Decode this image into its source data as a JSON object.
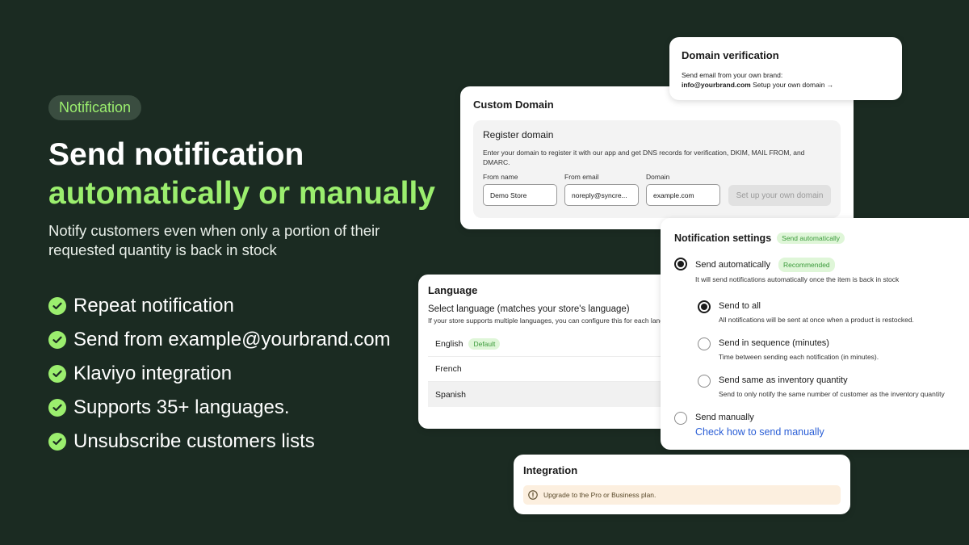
{
  "hero": {
    "pill": "Notification",
    "title_line1": "Send notification",
    "title_line2": "automatically or manually",
    "subtitle": "Notify customers even when only a portion of their requested quantity is back in stock",
    "features": [
      "Repeat notification",
      "Send from example@yourbrand.com",
      "Klaviyo integration",
      "Supports 35+ languages.",
      "Unsubscribe customers lists"
    ]
  },
  "domain_verification": {
    "title": "Domain verification",
    "line1": "Send email from your own brand:",
    "email": "info@yourbrand.com",
    "link": "Setup your own domain →"
  },
  "custom_domain": {
    "title": "Custom Domain",
    "register_title": "Register domain",
    "description": "Enter your domain to register it with our app and get DNS records for verification, DKIM, MAIL FROM, and DMARC.",
    "from_name_label": "From name",
    "from_name_value": "Demo Store",
    "from_email_label": "From email",
    "from_email_value": "noreply@syncre...",
    "domain_label": "Domain",
    "domain_value": "example.com",
    "button": "Set up your own domain"
  },
  "language": {
    "title": "Language",
    "select_label": "Select language (matches your store's language)",
    "hint": "If your store supports multiple languages, you can configure this for each language.",
    "languages": [
      {
        "name": "English",
        "badge": "Default"
      },
      {
        "name": "French"
      },
      {
        "name": "Spanish"
      }
    ]
  },
  "notification_settings": {
    "title": "Notification settings",
    "status_badge": "Send automatically",
    "auto_label": "Send automatically",
    "auto_badge": "Recommended",
    "auto_desc": "It will send notifications automatically once the item is back in stock",
    "all_label": "Send to all",
    "all_desc": "All notifications will be sent at once when a product is restocked.",
    "sequence_label": "Send in sequence (minutes)",
    "sequence_desc": "Time between sending each notification (in minutes).",
    "inventory_label": "Send same as inventory quantity",
    "inventory_desc": "Send to only notify the same number of customer as the inventory quantity",
    "manual_label": "Send manually",
    "manual_link": "Check how to send manually"
  },
  "integration": {
    "title": "Integration",
    "warning": "Upgrade to the Pro or Business plan."
  },
  "colors": {
    "background": "#1b2b22",
    "accent_green": "#9bee6e",
    "link_blue": "#2a5ed6",
    "warning_bg": "#fcefdf"
  }
}
